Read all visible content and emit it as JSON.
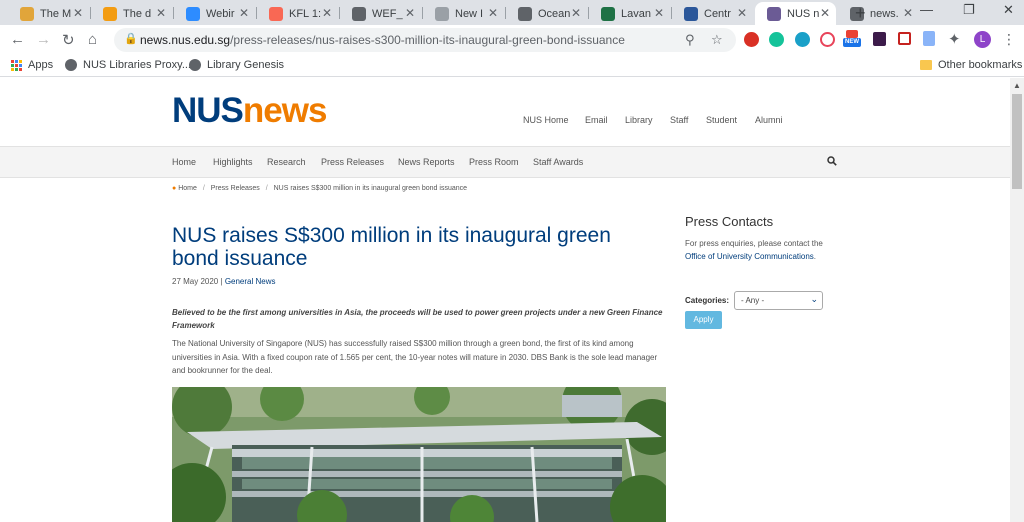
{
  "browser": {
    "tabs": [
      {
        "title": "The M",
        "color": "#e1a53a"
      },
      {
        "title": "The d",
        "color": "#f39c12"
      },
      {
        "title": "Webir",
        "color": "#2d8cff"
      },
      {
        "title": "KFL 1:",
        "color": "#f96854"
      },
      {
        "title": "WEF_",
        "color": "#5f6368"
      },
      {
        "title": "New I",
        "color": "#9aa0a6"
      },
      {
        "title": "Ocean",
        "color": "#5f6368"
      },
      {
        "title": "Lavan",
        "color": "#1e7145"
      },
      {
        "title": "Centr",
        "color": "#2b579a"
      },
      {
        "title": "NUS n",
        "color": "#6b5b95"
      },
      {
        "title": "news.",
        "color": "#5f6368"
      }
    ],
    "new_tab": "+",
    "url_host": "news.nus.edu.sg",
    "url_path": "/press-releases/nus-raises-s300-million-its-inaugural-green-bond-issuance",
    "profile_initial": "L",
    "new_badge": "NEW",
    "bookmarks": {
      "apps": "Apps",
      "nus_proxy": "NUS Libraries Proxy...",
      "libgen": "Library Genesis",
      "other": "Other bookmarks"
    }
  },
  "site": {
    "logo_nus": "NUS",
    "logo_news": "news",
    "top_links": [
      "NUS Home",
      "Email",
      "Library",
      "Staff",
      "Student",
      "Alumni"
    ],
    "nav": [
      "Home",
      "Highlights",
      "Research",
      "Press Releases",
      "News Reports",
      "Press Room",
      "Staff Awards"
    ],
    "breadcrumb": {
      "home": "Home",
      "section": "Press Releases",
      "current": "NUS raises S$300 million in its inaugural green bond issuance"
    }
  },
  "article": {
    "title": "NUS raises S$300 million in its inaugural green bond issuance",
    "date": "27 May 2020",
    "separator": "|",
    "category": "General News",
    "lead": "Believed to be the first among universities in Asia, the proceeds will be used to power green projects under a new Green Finance Framework",
    "body": "The National University of Singapore (NUS) has successfully raised S$300 million through a green bond, the first of its kind among universities in Asia. With a fixed coupon rate of 1.565 per cent, the 10-year notes will mature in 2030. DBS Bank is the sole lead manager and bookrunner for the deal."
  },
  "sidebar": {
    "title": "Press Contacts",
    "text_before": "For press enquiries, please contact the",
    "link": "Office of University Communications",
    "text_after": ".",
    "categories_label": "Categories:",
    "select_value": "- Any -",
    "apply_label": "Apply"
  }
}
